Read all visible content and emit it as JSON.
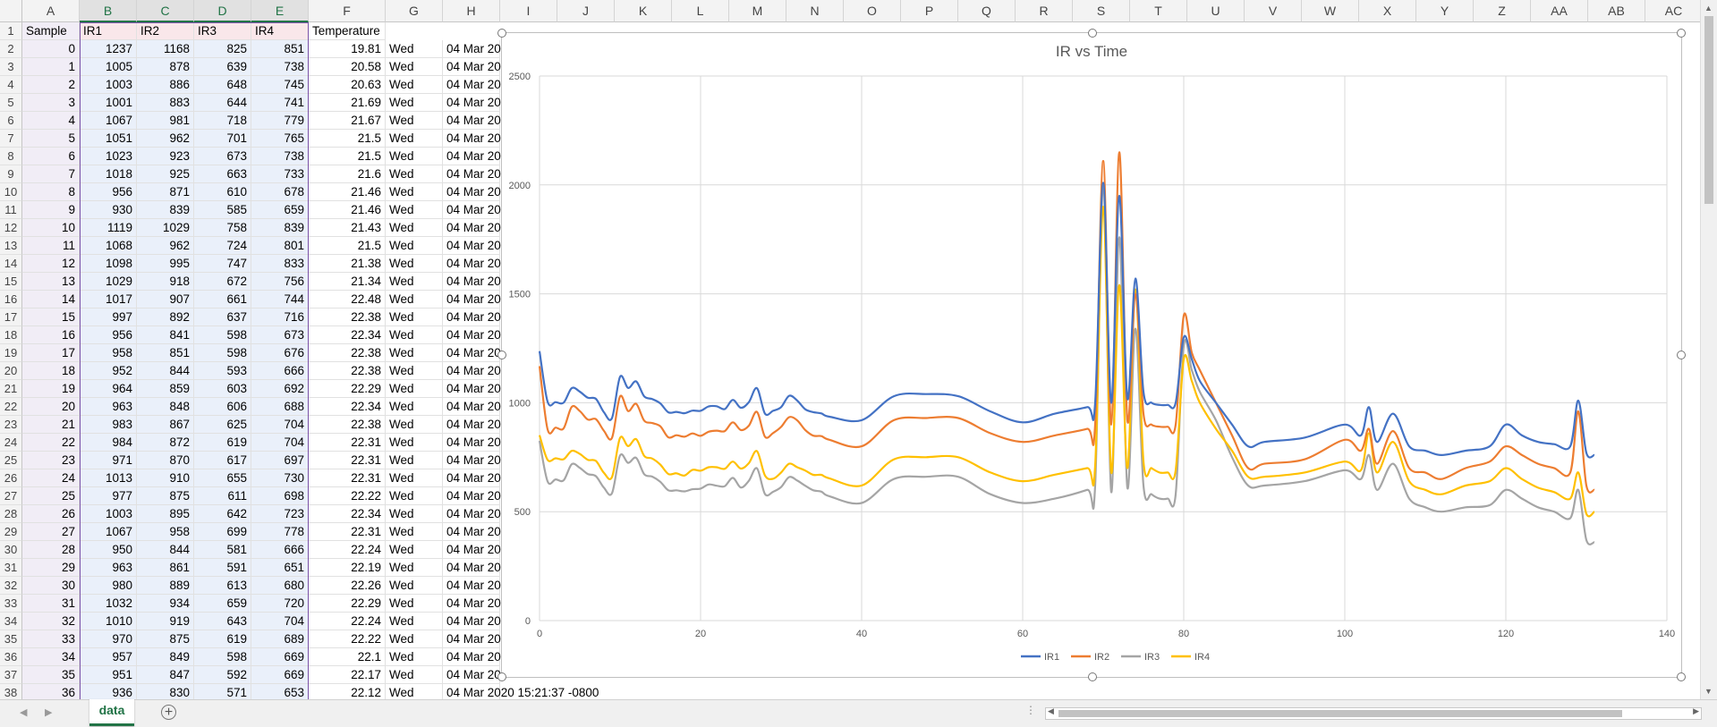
{
  "columns": [
    "A",
    "B",
    "C",
    "D",
    "E",
    "F",
    "G",
    "H",
    "I",
    "J",
    "K",
    "L",
    "M",
    "N",
    "O",
    "P",
    "Q",
    "R",
    "S",
    "T",
    "U",
    "V",
    "W",
    "X",
    "Y",
    "Z",
    "AA",
    "AB",
    "AC"
  ],
  "header_row": [
    "Sample",
    "IR1",
    "IR2",
    "IR3",
    "IR4",
    "Temperature"
  ],
  "rows": [
    [
      "0",
      "1237",
      "1168",
      "825",
      "851",
      "19.81",
      "Wed",
      "04 Mar 20"
    ],
    [
      "1",
      "1005",
      "878",
      "639",
      "738",
      "20.58",
      "Wed",
      "04 Mar 20"
    ],
    [
      "2",
      "1003",
      "886",
      "648",
      "745",
      "20.63",
      "Wed",
      "04 Mar 20"
    ],
    [
      "3",
      "1001",
      "883",
      "644",
      "741",
      "21.69",
      "Wed",
      "04 Mar 20"
    ],
    [
      "4",
      "1067",
      "981",
      "718",
      "779",
      "21.67",
      "Wed",
      "04 Mar 20"
    ],
    [
      "5",
      "1051",
      "962",
      "701",
      "765",
      "21.5",
      "Wed",
      "04 Mar 20"
    ],
    [
      "6",
      "1023",
      "923",
      "673",
      "738",
      "21.5",
      "Wed",
      "04 Mar 20"
    ],
    [
      "7",
      "1018",
      "925",
      "663",
      "733",
      "21.6",
      "Wed",
      "04 Mar 20"
    ],
    [
      "8",
      "956",
      "871",
      "610",
      "678",
      "21.46",
      "Wed",
      "04 Mar 20"
    ],
    [
      "9",
      "930",
      "839",
      "585",
      "659",
      "21.46",
      "Wed",
      "04 Mar 20"
    ],
    [
      "10",
      "1119",
      "1029",
      "758",
      "839",
      "21.43",
      "Wed",
      "04 Mar 20"
    ],
    [
      "11",
      "1068",
      "962",
      "724",
      "801",
      "21.5",
      "Wed",
      "04 Mar 20"
    ],
    [
      "12",
      "1098",
      "995",
      "747",
      "833",
      "21.38",
      "Wed",
      "04 Mar 20"
    ],
    [
      "13",
      "1029",
      "918",
      "672",
      "756",
      "21.34",
      "Wed",
      "04 Mar 20"
    ],
    [
      "14",
      "1017",
      "907",
      "661",
      "744",
      "22.48",
      "Wed",
      "04 Mar 20"
    ],
    [
      "15",
      "997",
      "892",
      "637",
      "716",
      "22.38",
      "Wed",
      "04 Mar 20"
    ],
    [
      "16",
      "956",
      "841",
      "598",
      "673",
      "22.34",
      "Wed",
      "04 Mar 20"
    ],
    [
      "17",
      "958",
      "851",
      "598",
      "676",
      "22.38",
      "Wed",
      "04 Mar 20"
    ],
    [
      "18",
      "952",
      "844",
      "593",
      "666",
      "22.38",
      "Wed",
      "04 Mar 20"
    ],
    [
      "19",
      "964",
      "859",
      "603",
      "692",
      "22.29",
      "Wed",
      "04 Mar 20"
    ],
    [
      "20",
      "963",
      "848",
      "606",
      "688",
      "22.34",
      "Wed",
      "04 Mar 20"
    ],
    [
      "21",
      "983",
      "867",
      "625",
      "704",
      "22.38",
      "Wed",
      "04 Mar 20"
    ],
    [
      "22",
      "984",
      "872",
      "619",
      "704",
      "22.31",
      "Wed",
      "04 Mar 20"
    ],
    [
      "23",
      "971",
      "870",
      "617",
      "697",
      "22.31",
      "Wed",
      "04 Mar 20"
    ],
    [
      "24",
      "1013",
      "910",
      "655",
      "730",
      "22.31",
      "Wed",
      "04 Mar 20"
    ],
    [
      "25",
      "977",
      "875",
      "611",
      "698",
      "22.22",
      "Wed",
      "04 Mar 20"
    ],
    [
      "26",
      "1003",
      "895",
      "642",
      "723",
      "22.34",
      "Wed",
      "04 Mar 20"
    ],
    [
      "27",
      "1067",
      "958",
      "699",
      "778",
      "22.31",
      "Wed",
      "04 Mar 20"
    ],
    [
      "28",
      "950",
      "844",
      "581",
      "666",
      "22.24",
      "Wed",
      "04 Mar 20"
    ],
    [
      "29",
      "963",
      "861",
      "591",
      "651",
      "22.19",
      "Wed",
      "04 Mar 20"
    ],
    [
      "30",
      "980",
      "889",
      "613",
      "680",
      "22.26",
      "Wed",
      "04 Mar 20"
    ],
    [
      "31",
      "1032",
      "934",
      "659",
      "720",
      "22.29",
      "Wed",
      "04 Mar 20"
    ],
    [
      "32",
      "1010",
      "919",
      "643",
      "704",
      "22.24",
      "Wed",
      "04 Mar 20"
    ],
    [
      "33",
      "970",
      "875",
      "619",
      "689",
      "22.22",
      "Wed",
      "04 Mar 20"
    ],
    [
      "34",
      "957",
      "849",
      "598",
      "669",
      "22.1",
      "Wed",
      "04 Mar 20"
    ],
    [
      "35",
      "951",
      "847",
      "592",
      "669",
      "22.17",
      "Wed",
      "04 Mar 20"
    ],
    [
      "36",
      "936",
      "830",
      "571",
      "653",
      "22.12",
      "Wed",
      "04 Mar 2020 15:21:37 -0800"
    ]
  ],
  "sheet_tab": "data",
  "add_sheet_glyph": "+",
  "chart_data": {
    "type": "line",
    "title": "IR vs Time",
    "xlabel": "",
    "ylabel": "",
    "xlim": [
      0,
      140
    ],
    "ylim": [
      0,
      2500
    ],
    "xticks": [
      0,
      20,
      40,
      60,
      80,
      100,
      120,
      140
    ],
    "yticks": [
      0,
      500,
      1000,
      1500,
      2000,
      2500
    ],
    "grid": true,
    "legend_position": "bottom",
    "smooth": true,
    "colors": {
      "IR1": "#4472c4",
      "IR2": "#ed7d31",
      "IR3": "#a5a5a5",
      "IR4": "#ffc000"
    },
    "series": [
      {
        "name": "IR1",
        "x": [
          0,
          1,
          2,
          3,
          4,
          5,
          6,
          7,
          8,
          9,
          10,
          11,
          12,
          13,
          14,
          15,
          16,
          17,
          18,
          19,
          20,
          21,
          22,
          23,
          24,
          25,
          26,
          27,
          28,
          29,
          30,
          31,
          32,
          33,
          34,
          35,
          36,
          40,
          44,
          48,
          52,
          56,
          60,
          64,
          68,
          69,
          70,
          71,
          72,
          73,
          74,
          75,
          76,
          77,
          78,
          79,
          80,
          81,
          82,
          84,
          86,
          88,
          90,
          95,
          100,
          102,
          103,
          104,
          106,
          108,
          110,
          112,
          115,
          118,
          120,
          122,
          124,
          126,
          128,
          129,
          130,
          131
        ],
        "y": [
          1237,
          1005,
          1003,
          1001,
          1067,
          1051,
          1023,
          1018,
          956,
          930,
          1119,
          1068,
          1098,
          1029,
          1017,
          997,
          956,
          958,
          952,
          964,
          963,
          983,
          984,
          971,
          1013,
          977,
          1003,
          1067,
          950,
          963,
          980,
          1032,
          1010,
          970,
          957,
          951,
          936,
          920,
          1030,
          1040,
          1030,
          960,
          910,
          950,
          980,
          1000,
          2010,
          1000,
          1950,
          1020,
          1570,
          1050,
          1000,
          990,
          990,
          1000,
          1300,
          1200,
          1100,
          1000,
          900,
          800,
          820,
          840,
          900,
          850,
          980,
          820,
          950,
          800,
          780,
          760,
          780,
          800,
          900,
          850,
          820,
          810,
          800,
          1010,
          770,
          760
        ]
      },
      {
        "name": "IR2",
        "x": [
          0,
          1,
          2,
          3,
          4,
          5,
          6,
          7,
          8,
          9,
          10,
          11,
          12,
          13,
          14,
          15,
          16,
          17,
          18,
          19,
          20,
          21,
          22,
          23,
          24,
          25,
          26,
          27,
          28,
          29,
          30,
          31,
          32,
          33,
          34,
          35,
          36,
          40,
          44,
          48,
          52,
          56,
          60,
          64,
          68,
          69,
          70,
          71,
          72,
          73,
          74,
          75,
          76,
          77,
          78,
          79,
          80,
          81,
          82,
          84,
          86,
          88,
          90,
          95,
          100,
          102,
          103,
          104,
          106,
          108,
          110,
          112,
          115,
          118,
          120,
          122,
          124,
          126,
          128,
          129,
          130,
          131
        ],
        "y": [
          1168,
          878,
          886,
          883,
          981,
          962,
          923,
          925,
          871,
          839,
          1029,
          962,
          995,
          918,
          907,
          892,
          841,
          851,
          844,
          859,
          848,
          867,
          872,
          870,
          910,
          875,
          895,
          958,
          844,
          861,
          889,
          934,
          919,
          875,
          849,
          847,
          830,
          800,
          920,
          930,
          930,
          860,
          820,
          850,
          880,
          900,
          2110,
          900,
          2150,
          920,
          1500,
          950,
          900,
          890,
          890,
          900,
          1400,
          1230,
          1150,
          1000,
          850,
          700,
          720,
          740,
          830,
          780,
          880,
          720,
          870,
          700,
          680,
          650,
          700,
          730,
          800,
          760,
          720,
          700,
          680,
          960,
          620,
          600
        ]
      },
      {
        "name": "IR3",
        "x": [
          0,
          1,
          2,
          3,
          4,
          5,
          6,
          7,
          8,
          9,
          10,
          11,
          12,
          13,
          14,
          15,
          16,
          17,
          18,
          19,
          20,
          21,
          22,
          23,
          24,
          25,
          26,
          27,
          28,
          29,
          30,
          31,
          32,
          33,
          34,
          35,
          36,
          40,
          44,
          48,
          52,
          56,
          60,
          64,
          68,
          69,
          70,
          71,
          72,
          73,
          74,
          75,
          76,
          77,
          78,
          79,
          80,
          81,
          82,
          84,
          86,
          88,
          90,
          95,
          100,
          102,
          103,
          104,
          106,
          108,
          110,
          112,
          115,
          118,
          120,
          122,
          124,
          126,
          128,
          129,
          130,
          131
        ],
        "y": [
          825,
          639,
          648,
          644,
          718,
          701,
          673,
          663,
          610,
          585,
          758,
          724,
          747,
          672,
          661,
          637,
          598,
          598,
          593,
          603,
          606,
          625,
          619,
          617,
          655,
          611,
          642,
          699,
          581,
          591,
          613,
          659,
          643,
          619,
          598,
          592,
          571,
          540,
          650,
          660,
          660,
          580,
          540,
          560,
          600,
          620,
          2000,
          590,
          1760,
          610,
          1340,
          620,
          580,
          560,
          560,
          580,
          1260,
          1150,
          1050,
          920,
          750,
          620,
          620,
          640,
          690,
          650,
          760,
          600,
          720,
          560,
          520,
          500,
          520,
          530,
          600,
          560,
          520,
          500,
          470,
          600,
          370,
          360
        ]
      },
      {
        "name": "IR4",
        "x": [
          0,
          1,
          2,
          3,
          4,
          5,
          6,
          7,
          8,
          9,
          10,
          11,
          12,
          13,
          14,
          15,
          16,
          17,
          18,
          19,
          20,
          21,
          22,
          23,
          24,
          25,
          26,
          27,
          28,
          29,
          30,
          31,
          32,
          33,
          34,
          35,
          36,
          40,
          44,
          48,
          52,
          56,
          60,
          64,
          68,
          69,
          70,
          71,
          72,
          73,
          74,
          75,
          76,
          77,
          78,
          79,
          80,
          81,
          82,
          84,
          86,
          88,
          90,
          95,
          100,
          102,
          103,
          104,
          106,
          108,
          110,
          112,
          115,
          118,
          120,
          122,
          124,
          126,
          128,
          129,
          130,
          131
        ],
        "y": [
          851,
          738,
          745,
          741,
          779,
          765,
          738,
          733,
          678,
          659,
          839,
          801,
          833,
          756,
          744,
          716,
          673,
          676,
          666,
          692,
          688,
          704,
          704,
          697,
          730,
          698,
          723,
          778,
          666,
          651,
          680,
          720,
          704,
          689,
          669,
          669,
          653,
          620,
          740,
          750,
          750,
          680,
          640,
          670,
          700,
          710,
          1900,
          680,
          1540,
          700,
          1520,
          730,
          700,
          680,
          680,
          690,
          1200,
          1100,
          1000,
          880,
          780,
          660,
          660,
          680,
          730,
          690,
          860,
          680,
          820,
          640,
          600,
          580,
          620,
          640,
          700,
          650,
          610,
          590,
          560,
          680,
          490,
          500
        ]
      }
    ]
  }
}
